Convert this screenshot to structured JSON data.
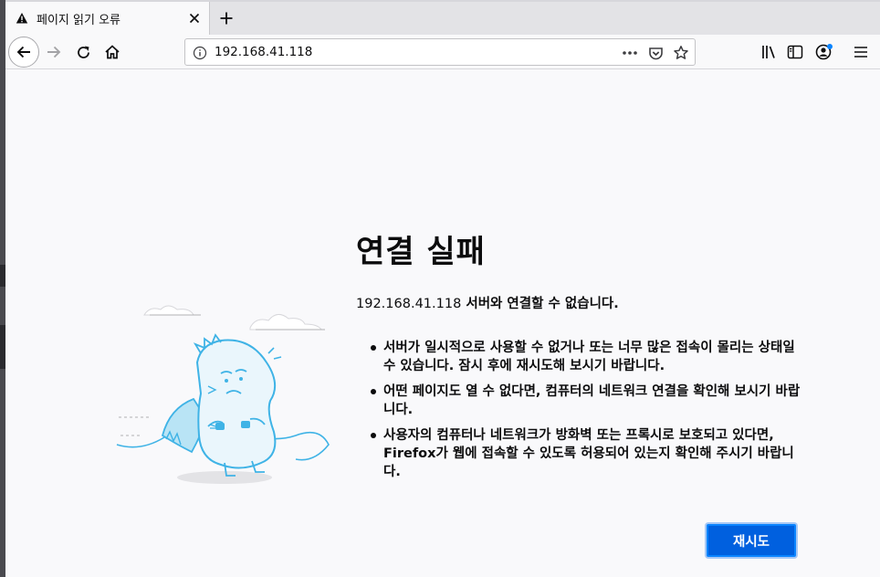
{
  "tab": {
    "title": "페이지 읽기 오류",
    "warn_icon": "warning-icon",
    "close_icon": "close-icon"
  },
  "toolbar": {
    "new_tab_icon": "plus-icon",
    "back_icon": "back-arrow-icon",
    "forward_icon": "forward-arrow-icon",
    "reload_icon": "reload-icon",
    "home_icon": "home-icon",
    "library_icon": "library-icon",
    "sidebar_icon": "sidebar-icon",
    "account_icon": "account-icon",
    "menu_icon": "hamburger-menu-icon"
  },
  "urlbar": {
    "url": "192.168.41.118",
    "more_icon": "more-dots-icon",
    "pocket_icon": "pocket-icon",
    "bookmark_icon": "star-icon"
  },
  "error": {
    "title": "연결 실패",
    "ip": "192.168.41.118",
    "message": " 서버와 연결할 수 없습니다.",
    "bullets": [
      "서버가 일시적으로 사용할 수 없거나 또는 너무 많은 접속이 몰리는 상태일 수 있습니다. 잠시 후에 재시도해 보시기 바랍니다.",
      "어떤 페이지도 열 수 없다면, 컴퓨터의 네트워크 연결을 확인해 보시기 바랍니다.",
      "사용자의 컴퓨터나 네트워크가 방화벽 또는 프록시로 보호되고 있다면, Firefox가 웹에 접속할 수 있도록 허용되어 있는지 확인해 주시기 바랍니다."
    ],
    "retry_label": "재시도"
  },
  "colors": {
    "accent": "#0060df",
    "illustration": "#3fb3e6"
  }
}
